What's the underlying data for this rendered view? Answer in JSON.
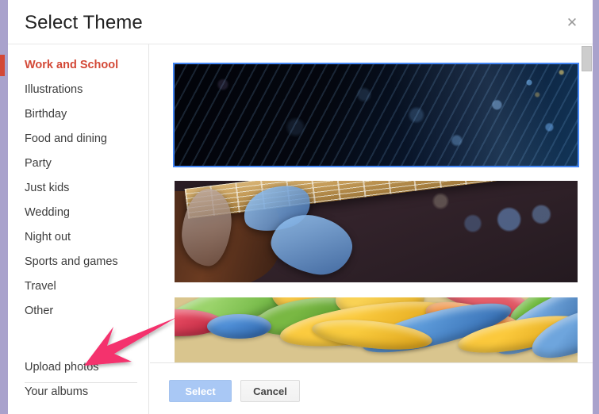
{
  "dialog": {
    "title": "Select Theme",
    "close_icon": "close-icon",
    "close_glyph": "✕"
  },
  "sidebar": {
    "categories": [
      {
        "label": "Work and School",
        "selected": true
      },
      {
        "label": "Illustrations",
        "selected": false
      },
      {
        "label": "Birthday",
        "selected": false
      },
      {
        "label": "Food and dining",
        "selected": false
      },
      {
        "label": "Party",
        "selected": false
      },
      {
        "label": "Just kids",
        "selected": false
      },
      {
        "label": "Wedding",
        "selected": false
      },
      {
        "label": "Night out",
        "selected": false
      },
      {
        "label": "Sports and games",
        "selected": false
      },
      {
        "label": "Travel",
        "selected": false
      },
      {
        "label": "Other",
        "selected": false
      }
    ],
    "actions": [
      {
        "label": "Upload photos"
      },
      {
        "label": "Your albums"
      }
    ]
  },
  "content": {
    "thumbnails": [
      {
        "name": "fiber-optic-lights-theme",
        "selected": true
      },
      {
        "name": "guitar-player-theme",
        "selected": false
      },
      {
        "name": "colorful-candy-theme",
        "selected": false
      }
    ],
    "scrollbar": {
      "name": "vertical-scrollbar"
    }
  },
  "footer": {
    "select_label": "Select",
    "cancel_label": "Cancel"
  },
  "annotation": {
    "arrow_color": "#f4306d",
    "points_to": "Upload photos"
  },
  "colors": {
    "window_border": "#a9a2cc",
    "selected_category": "#d34836",
    "selection_outline": "#4285f4",
    "primary_button": "#a9c8f5"
  }
}
